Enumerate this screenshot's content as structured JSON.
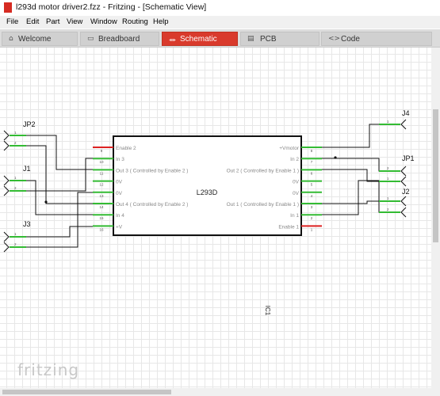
{
  "window": {
    "title": "l293d motor driver2.fzz - Fritzing - [Schematic View]",
    "icon": "fritzing-app-icon"
  },
  "menu": [
    "File",
    "Edit",
    "Part",
    "View",
    "Window",
    "Routing",
    "Help"
  ],
  "tabs": [
    {
      "label": "Welcome",
      "icon": "home-icon",
      "active": false
    },
    {
      "label": "Breadboard",
      "icon": "breadboard-icon",
      "active": false
    },
    {
      "label": "Schematic",
      "icon": "schematic-icon",
      "active": true
    },
    {
      "label": "PCB",
      "icon": "pcb-icon",
      "active": false
    },
    {
      "label": "Code",
      "icon": "code-icon",
      "active": false
    }
  ],
  "chip": {
    "name": "L293D",
    "reference": "IC1",
    "left_pins": [
      {
        "label": "Enable 2",
        "number": "9"
      },
      {
        "label": "In 3",
        "number": "10"
      },
      {
        "label": "Out 3 ( Controlled by Enable 2 )",
        "number": "11"
      },
      {
        "label": "0V",
        "number": "12"
      },
      {
        "label": "0V",
        "number": "13"
      },
      {
        "label": "Out 4 ( Controlled by Enable 2 )",
        "number": "14"
      },
      {
        "label": "In 4",
        "number": "15"
      },
      {
        "label": "+V",
        "number": "16"
      }
    ],
    "right_pins": [
      {
        "label": "+Vmotor",
        "number": "8"
      },
      {
        "label": "In 2",
        "number": "7"
      },
      {
        "label": "Out 2 ( Controlled by Enable 1 )",
        "number": "6"
      },
      {
        "label": "0V",
        "number": "5"
      },
      {
        "label": "0V",
        "number": "4"
      },
      {
        "label": "Out 1 ( Controlled by Enable 1 )",
        "number": "3"
      },
      {
        "label": "In 1",
        "number": "2"
      },
      {
        "label": "Enable 1",
        "number": "1"
      }
    ]
  },
  "connectors": {
    "jp2": {
      "label": "JP2",
      "pins": [
        "1",
        "2"
      ]
    },
    "j1": {
      "label": "J1",
      "pins": [
        "1",
        "2"
      ]
    },
    "j3": {
      "label": "J3",
      "pins": [
        "1",
        "2"
      ]
    },
    "j4": {
      "label": "J4",
      "pins": [
        "1"
      ]
    },
    "jp1": {
      "label": "JP1",
      "pins": [
        "2",
        "1"
      ]
    },
    "j2": {
      "label": "J2",
      "pins": [
        "1",
        "2"
      ]
    }
  },
  "watermark": "fritzing",
  "colors": {
    "active_tab": "#d93a2c",
    "pin_green": "#33bb33",
    "pin_red": "#dd2222",
    "wire": "#111111"
  }
}
